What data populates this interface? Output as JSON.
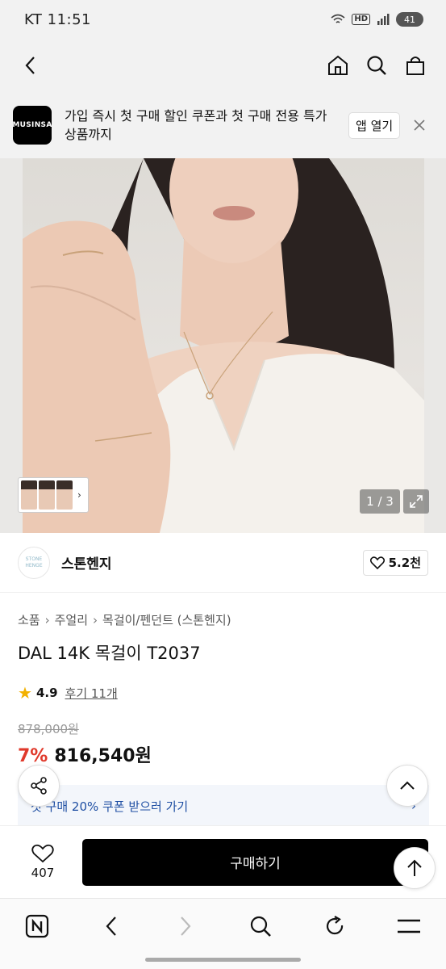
{
  "status_bar": {
    "carrier_time": "KT 11:51",
    "hd_badge": "HD",
    "battery": "41"
  },
  "banner": {
    "logo_text": "MUSINSA",
    "message": "가입 즉시 첫 구매 할인 쿠폰과 첫 구매 전용 특가 상품까지",
    "open_label": "앱 열기"
  },
  "gallery": {
    "counter": "1 / 3"
  },
  "brand": {
    "logo_text": "STONE HENGE",
    "name": "스톤헨지",
    "likes": "5.2천"
  },
  "breadcrumb": [
    "소품",
    "주얼리",
    "목걸이/펜던트 (스톤헨지)"
  ],
  "product": {
    "title": "DAL 14K 목걸이 T2037",
    "rating": "4.9",
    "review_link": "후기 11개",
    "original_price": "878,000원",
    "discount": "7%",
    "price": "816,540원"
  },
  "coupon": {
    "text": "첫 구매 20% 쿠폰 받으러 가기",
    "arrow": "›"
  },
  "buy_bar": {
    "wish_count": "407",
    "buy_label": "구매하기"
  },
  "colors": {
    "discount": "#e0392b",
    "coupon_text": "#1f4fa3",
    "buy_button": "#000000",
    "star": "#f2b100"
  }
}
